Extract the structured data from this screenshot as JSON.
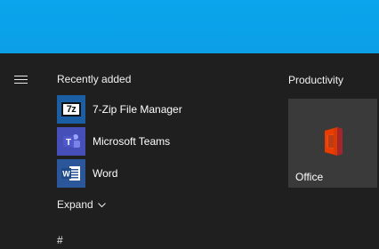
{
  "start_menu": {
    "recently_added_title": "Recently added",
    "recent_apps": [
      {
        "label": "7-Zip File Manager",
        "icon": "7zip-icon",
        "icon_text": "7z"
      },
      {
        "label": "Microsoft Teams",
        "icon": "teams-icon",
        "icon_text": "T"
      },
      {
        "label": "Word",
        "icon": "word-icon",
        "icon_text": "W"
      }
    ],
    "expand_label": "Expand",
    "section_letter": "#",
    "group_title": "Productivity",
    "tiles": [
      {
        "label": "Office",
        "icon": "office-icon"
      }
    ]
  },
  "colors": {
    "desktop_blue": "#0aa5ec",
    "menu_background": "#1f1f1f",
    "tile_background": "#3a3a3a",
    "zip_blue": "#1b5ea3",
    "teams_purple": "#464eb8",
    "word_blue": "#2b579a",
    "office_red": "#d83b01"
  }
}
